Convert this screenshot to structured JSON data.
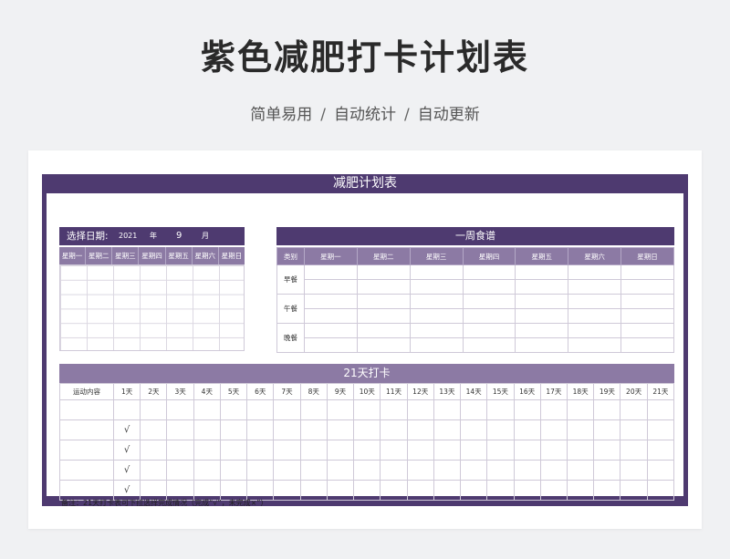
{
  "header": {
    "title": "紫色减肥打卡计划表",
    "subtitle_parts": [
      "简单易用",
      "/",
      "自动统计",
      "/",
      "自动更新"
    ]
  },
  "sheet": {
    "title": "减肥计划表",
    "date_select": {
      "label": "选择日期:",
      "year_value": "2021",
      "year_unit": "年",
      "month_value": "9",
      "month_unit": "月"
    },
    "calendar_weekdays": [
      "星期一",
      "星期二",
      "星期三",
      "星期四",
      "星期五",
      "星期六",
      "星期日"
    ],
    "meal_plan": {
      "title": "一周食谱",
      "category_header": "类别",
      "weekdays": [
        "星期一",
        "星期二",
        "星期三",
        "星期四",
        "星期五",
        "星期六",
        "星期日"
      ],
      "meals": [
        "早餐",
        "午餐",
        "晚餐"
      ]
    },
    "checkin": {
      "title": "21天打卡",
      "first_header": "运动内容",
      "days": [
        "1天",
        "2天",
        "3天",
        "4天",
        "5天",
        "6天",
        "7天",
        "8天",
        "9天",
        "10天",
        "11天",
        "12天",
        "13天",
        "14天",
        "15天",
        "16天",
        "17天",
        "18天",
        "19天",
        "20天",
        "21天"
      ],
      "rows": [
        {
          "content": "",
          "day1": ""
        },
        {
          "content": "",
          "day1": "√"
        },
        {
          "content": "",
          "day1": "√"
        },
        {
          "content": "",
          "day1": "√"
        },
        {
          "content": "",
          "day1": "√"
        }
      ]
    },
    "note": "备注：21天打卡表可下拉选择完成情况（完成“√”，未完成×”）"
  },
  "colors": {
    "primary": "#4e3a70",
    "secondary": "#8c7aa4",
    "background": "#f0f1f3"
  }
}
